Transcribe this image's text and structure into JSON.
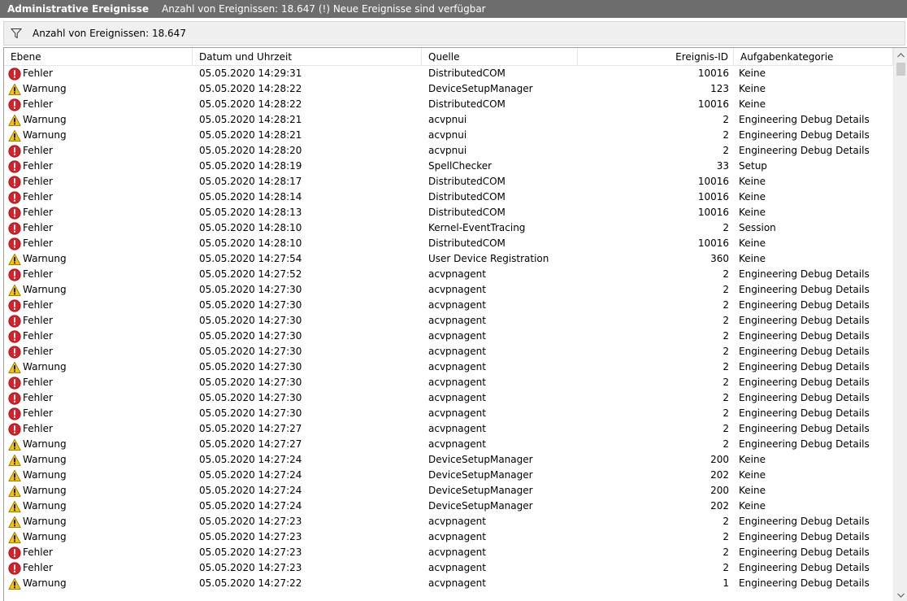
{
  "titlebar": {
    "title": "Administrative Ereignisse",
    "info": "Anzahl von Ereignissen: 18.647 (!) Neue Ereignisse sind verfügbar"
  },
  "filterbar": {
    "icon": "filter-icon",
    "count_text": "Anzahl von Ereignissen: 18.647"
  },
  "columns": [
    "Ebene",
    "Datum und Uhrzeit",
    "Quelle",
    "Ereignis-ID",
    "Aufgabenkategorie"
  ],
  "level_icons": {
    "Fehler": "error-icon",
    "Warnung": "warning-icon"
  },
  "colors": {
    "error": "#d6202a",
    "warning": "#f5c400",
    "titlebar": "#6d6d6d"
  },
  "events": [
    {
      "level": "Fehler",
      "datetime": "05.05.2020 14:29:31",
      "source": "DistributedCOM",
      "id": "10016",
      "category": "Keine"
    },
    {
      "level": "Warnung",
      "datetime": "05.05.2020 14:28:22",
      "source": "DeviceSetupManager",
      "id": "123",
      "category": "Keine"
    },
    {
      "level": "Fehler",
      "datetime": "05.05.2020 14:28:22",
      "source": "DistributedCOM",
      "id": "10016",
      "category": "Keine"
    },
    {
      "level": "Warnung",
      "datetime": "05.05.2020 14:28:21",
      "source": "acvpnui",
      "id": "2",
      "category": "Engineering Debug Details"
    },
    {
      "level": "Warnung",
      "datetime": "05.05.2020 14:28:21",
      "source": "acvpnui",
      "id": "2",
      "category": "Engineering Debug Details"
    },
    {
      "level": "Fehler",
      "datetime": "05.05.2020 14:28:20",
      "source": "acvpnui",
      "id": "2",
      "category": "Engineering Debug Details"
    },
    {
      "level": "Fehler",
      "datetime": "05.05.2020 14:28:19",
      "source": "SpellChecker",
      "id": "33",
      "category": "Setup"
    },
    {
      "level": "Fehler",
      "datetime": "05.05.2020 14:28:17",
      "source": "DistributedCOM",
      "id": "10016",
      "category": "Keine"
    },
    {
      "level": "Fehler",
      "datetime": "05.05.2020 14:28:14",
      "source": "DistributedCOM",
      "id": "10016",
      "category": "Keine"
    },
    {
      "level": "Fehler",
      "datetime": "05.05.2020 14:28:13",
      "source": "DistributedCOM",
      "id": "10016",
      "category": "Keine"
    },
    {
      "level": "Fehler",
      "datetime": "05.05.2020 14:28:10",
      "source": "Kernel-EventTracing",
      "id": "2",
      "category": "Session"
    },
    {
      "level": "Fehler",
      "datetime": "05.05.2020 14:28:10",
      "source": "DistributedCOM",
      "id": "10016",
      "category": "Keine"
    },
    {
      "level": "Warnung",
      "datetime": "05.05.2020 14:27:54",
      "source": "User Device Registration",
      "id": "360",
      "category": "Keine"
    },
    {
      "level": "Fehler",
      "datetime": "05.05.2020 14:27:52",
      "source": "acvpnagent",
      "id": "2",
      "category": "Engineering Debug Details"
    },
    {
      "level": "Warnung",
      "datetime": "05.05.2020 14:27:30",
      "source": "acvpnagent",
      "id": "2",
      "category": "Engineering Debug Details"
    },
    {
      "level": "Fehler",
      "datetime": "05.05.2020 14:27:30",
      "source": "acvpnagent",
      "id": "2",
      "category": "Engineering Debug Details"
    },
    {
      "level": "Fehler",
      "datetime": "05.05.2020 14:27:30",
      "source": "acvpnagent",
      "id": "2",
      "category": "Engineering Debug Details"
    },
    {
      "level": "Fehler",
      "datetime": "05.05.2020 14:27:30",
      "source": "acvpnagent",
      "id": "2",
      "category": "Engineering Debug Details"
    },
    {
      "level": "Fehler",
      "datetime": "05.05.2020 14:27:30",
      "source": "acvpnagent",
      "id": "2",
      "category": "Engineering Debug Details"
    },
    {
      "level": "Warnung",
      "datetime": "05.05.2020 14:27:30",
      "source": "acvpnagent",
      "id": "2",
      "category": "Engineering Debug Details"
    },
    {
      "level": "Fehler",
      "datetime": "05.05.2020 14:27:30",
      "source": "acvpnagent",
      "id": "2",
      "category": "Engineering Debug Details"
    },
    {
      "level": "Fehler",
      "datetime": "05.05.2020 14:27:30",
      "source": "acvpnagent",
      "id": "2",
      "category": "Engineering Debug Details"
    },
    {
      "level": "Fehler",
      "datetime": "05.05.2020 14:27:30",
      "source": "acvpnagent",
      "id": "2",
      "category": "Engineering Debug Details"
    },
    {
      "level": "Fehler",
      "datetime": "05.05.2020 14:27:27",
      "source": "acvpnagent",
      "id": "2",
      "category": "Engineering Debug Details"
    },
    {
      "level": "Warnung",
      "datetime": "05.05.2020 14:27:27",
      "source": "acvpnagent",
      "id": "2",
      "category": "Engineering Debug Details"
    },
    {
      "level": "Warnung",
      "datetime": "05.05.2020 14:27:24",
      "source": "DeviceSetupManager",
      "id": "200",
      "category": "Keine"
    },
    {
      "level": "Warnung",
      "datetime": "05.05.2020 14:27:24",
      "source": "DeviceSetupManager",
      "id": "202",
      "category": "Keine"
    },
    {
      "level": "Warnung",
      "datetime": "05.05.2020 14:27:24",
      "source": "DeviceSetupManager",
      "id": "200",
      "category": "Keine"
    },
    {
      "level": "Warnung",
      "datetime": "05.05.2020 14:27:24",
      "source": "DeviceSetupManager",
      "id": "202",
      "category": "Keine"
    },
    {
      "level": "Warnung",
      "datetime": "05.05.2020 14:27:23",
      "source": "acvpnagent",
      "id": "2",
      "category": "Engineering Debug Details"
    },
    {
      "level": "Warnung",
      "datetime": "05.05.2020 14:27:23",
      "source": "acvpnagent",
      "id": "2",
      "category": "Engineering Debug Details"
    },
    {
      "level": "Fehler",
      "datetime": "05.05.2020 14:27:23",
      "source": "acvpnagent",
      "id": "2",
      "category": "Engineering Debug Details"
    },
    {
      "level": "Fehler",
      "datetime": "05.05.2020 14:27:23",
      "source": "acvpnagent",
      "id": "2",
      "category": "Engineering Debug Details"
    },
    {
      "level": "Warnung",
      "datetime": "05.05.2020 14:27:22",
      "source": "acvpnagent",
      "id": "1",
      "category": "Engineering Debug Details"
    }
  ]
}
